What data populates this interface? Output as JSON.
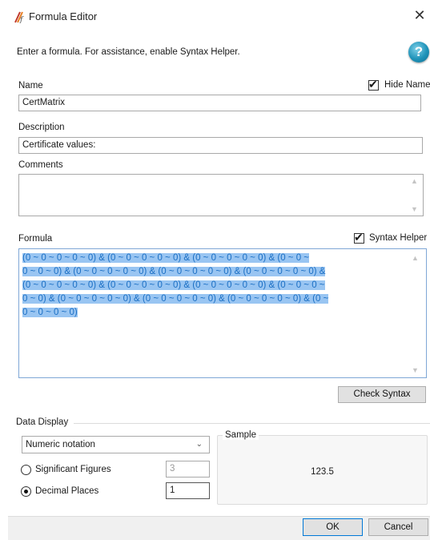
{
  "window": {
    "title": "Formula Editor",
    "close_glyph": "✕"
  },
  "instruction": "Enter a formula. For assistance, enable Syntax Helper.",
  "help_glyph": "?",
  "name": {
    "label": "Name",
    "value": "CertMatrix",
    "hide_label": "Hide Name",
    "hide_checked": true
  },
  "description": {
    "label": "Description",
    "value": "Certificate values:"
  },
  "comments": {
    "label": "Comments",
    "value": ""
  },
  "formula": {
    "label": "Formula",
    "syntax_helper_label": "Syntax Helper",
    "syntax_helper_checked": true,
    "lines": [
      "(0 ~ 0 ~ 0 ~ 0 ~ 0) & (0 ~ 0 ~ 0 ~ 0 ~ 0) & (0 ~ 0 ~ 0 ~ 0 ~ 0) & (0 ~ 0 ~",
      "0 ~ 0 ~ 0) & (0 ~ 0 ~ 0 ~ 0 ~ 0) & (0 ~ 0 ~ 0 ~ 0 ~ 0) & (0 ~ 0 ~ 0 ~ 0 ~ 0) &",
      "(0 ~ 0 ~ 0 ~ 0 ~ 0) & (0 ~ 0 ~ 0 ~ 0 ~ 0) & (0 ~ 0 ~ 0 ~ 0 ~ 0) & (0 ~ 0 ~ 0 ~",
      "0 ~ 0) & (0 ~ 0 ~ 0 ~ 0 ~ 0) & (0 ~ 0 ~ 0 ~ 0 ~ 0) & (0 ~ 0 ~ 0 ~ 0 ~ 0) & (0 ~",
      "0 ~ 0 ~ 0 ~ 0)"
    ],
    "check_syntax_label": "Check Syntax"
  },
  "data_display": {
    "group_label": "Data Display",
    "notation_selected": "Numeric notation",
    "significant_label": "Significant Figures",
    "significant_value": "3",
    "decimal_label": "Decimal Places",
    "decimal_value": "1",
    "selected_mode": "decimal_places",
    "sample_label": "Sample",
    "sample_value": "123.5"
  },
  "buttons": {
    "ok": "OK",
    "cancel": "Cancel"
  },
  "colors": {
    "selection": "#99c5f2",
    "formula_text": "#1b6fc4",
    "button_focus_border": "#0078d7"
  }
}
